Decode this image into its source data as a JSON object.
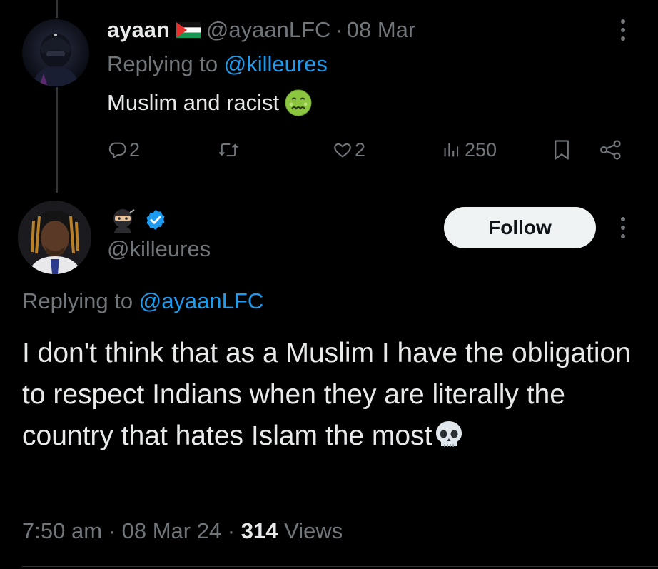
{
  "parent_tweet": {
    "author_name": "ayaan",
    "author_flag": "palestine-flag-icon",
    "author_handle": "@ayaanLFC",
    "separator": "·",
    "date": "08 Mar",
    "replying_prefix": "Replying to",
    "replying_to": "@killeures",
    "text": "Muslim and racist",
    "text_emoji": "nauseated-face-emoji",
    "stats": {
      "replies": "2",
      "retweets": "",
      "likes": "2",
      "views": "250"
    }
  },
  "main_tweet": {
    "author_display_emoji": "ninja-emoji",
    "verified": true,
    "author_handle": "@killeures",
    "follow_label": "Follow",
    "replying_prefix": "Replying to",
    "replying_to": "@ayaanLFC",
    "text": "I don't think that as a Muslim I have the obligation to respect Indians when they are literally the country that hates Islam the most",
    "text_emoji": "skull-emoji",
    "time": "7:50 am",
    "separator": "·",
    "date": "08 Mar 24",
    "view_count": "314",
    "views_label": "Views"
  },
  "colors": {
    "background": "#000000",
    "primary_text": "#e7e9ea",
    "secondary_text": "#71767b",
    "link": "#1d9bf0",
    "verified_badge": "#1d9bf0",
    "follow_button_bg": "#eff3f4",
    "follow_button_text": "#0f1419"
  }
}
